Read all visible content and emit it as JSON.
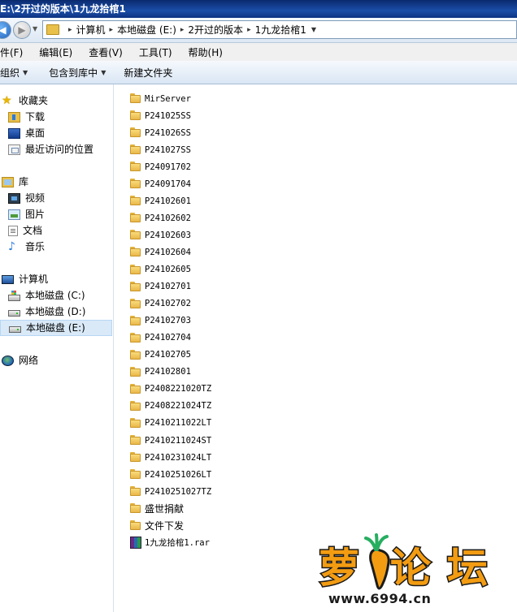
{
  "window": {
    "title": "E:\\2开过的版本\\1九龙拾棺1"
  },
  "address_bar": {
    "crumbs": [
      "计算机",
      "本地磁盘 (E:)",
      "2开过的版本",
      "1九龙拾棺1"
    ],
    "separator": "▸"
  },
  "menu": {
    "items": [
      "件(F)",
      "编辑(E)",
      "查看(V)",
      "工具(T)",
      "帮助(H)"
    ]
  },
  "toolbar": {
    "organize": "组织",
    "include_library": "包含到库中",
    "new_folder": "新建文件夹"
  },
  "nav_pane": {
    "favorites": {
      "label": "收藏夹",
      "items": [
        "下载",
        "桌面",
        "最近访问的位置"
      ]
    },
    "libraries": {
      "label": "库",
      "items": [
        "视频",
        "图片",
        "文档",
        "音乐"
      ]
    },
    "computer": {
      "label": "计算机",
      "drives": [
        "本地磁盘 (C:)",
        "本地磁盘 (D:)",
        "本地磁盘 (E:)"
      ],
      "selected": "本地磁盘 (E:)"
    },
    "network": {
      "label": "网络"
    }
  },
  "files": [
    {
      "name": "MirServer",
      "type": "folder"
    },
    {
      "name": "P241025SS",
      "type": "folder"
    },
    {
      "name": "P241026SS",
      "type": "folder"
    },
    {
      "name": "P241027SS",
      "type": "folder"
    },
    {
      "name": "P24091702",
      "type": "folder"
    },
    {
      "name": "P24091704",
      "type": "folder"
    },
    {
      "name": "P24102601",
      "type": "folder"
    },
    {
      "name": "P24102602",
      "type": "folder"
    },
    {
      "name": "P24102603",
      "type": "folder"
    },
    {
      "name": "P24102604",
      "type": "folder"
    },
    {
      "name": "P24102605",
      "type": "folder"
    },
    {
      "name": "P24102701",
      "type": "folder"
    },
    {
      "name": "P24102702",
      "type": "folder"
    },
    {
      "name": "P24102703",
      "type": "folder"
    },
    {
      "name": "P24102704",
      "type": "folder"
    },
    {
      "name": "P24102705",
      "type": "folder"
    },
    {
      "name": "P24102801",
      "type": "folder"
    },
    {
      "name": "P2408221020TZ",
      "type": "folder"
    },
    {
      "name": "P2408221024TZ",
      "type": "folder"
    },
    {
      "name": "P2410211022LT",
      "type": "folder"
    },
    {
      "name": "P2410211024ST",
      "type": "folder"
    },
    {
      "name": "P2410231024LT",
      "type": "folder"
    },
    {
      "name": "P2410251026LT",
      "type": "folder"
    },
    {
      "name": "P2410251027TZ",
      "type": "folder"
    },
    {
      "name": "盛世捐献",
      "type": "folder"
    },
    {
      "name": "文件下发",
      "type": "folder"
    },
    {
      "name": "1九龙拾棺1.rar",
      "type": "rar"
    }
  ],
  "watermark": {
    "brand": "萝卜论坛",
    "site": "www.6994.cn"
  },
  "colors": {
    "title_bar": "#1b4ea8",
    "selection": "#d9e9f8",
    "folder": "#f2c75a",
    "watermark_orange": "#f39c12"
  }
}
